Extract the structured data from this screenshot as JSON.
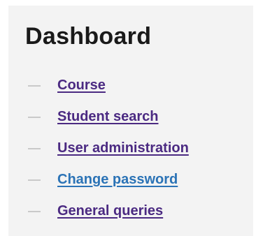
{
  "dashboard": {
    "title": "Dashboard",
    "links": [
      {
        "label": "Course",
        "color": "#4b2a82"
      },
      {
        "label": "Student search",
        "color": "#4b2a82"
      },
      {
        "label": "User administration",
        "color": "#4b2a82"
      },
      {
        "label": "Change password",
        "color": "#2b73b6"
      },
      {
        "label": "General queries",
        "color": "#4b2a82"
      }
    ]
  }
}
